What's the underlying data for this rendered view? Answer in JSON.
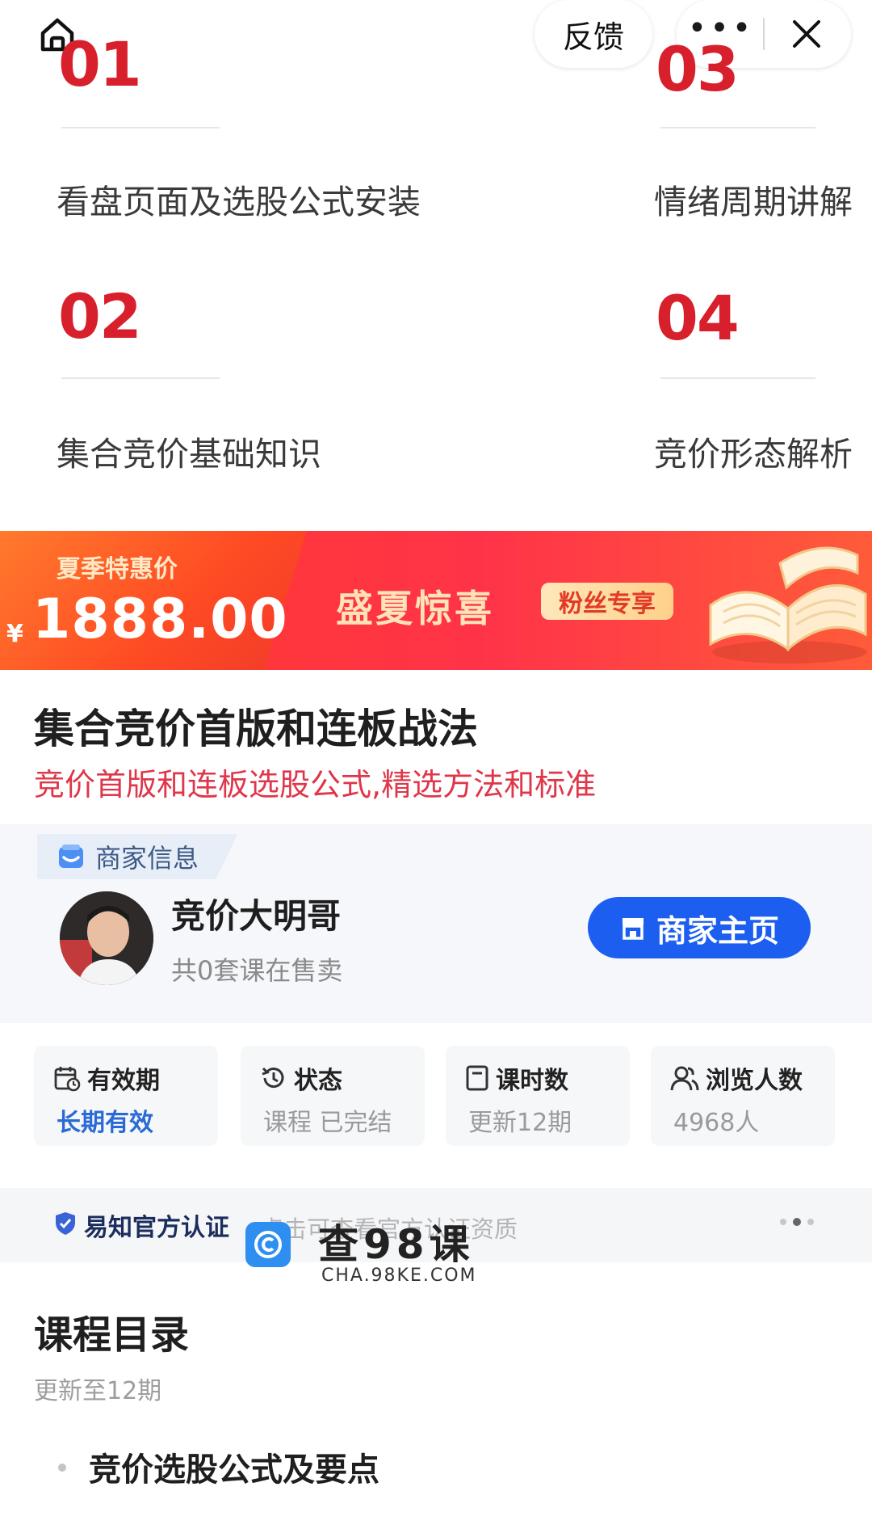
{
  "nav": {
    "feedback_label": "反馈",
    "more_label": "•••"
  },
  "chapters": [
    {
      "num": "01",
      "title": "看盘页面及选股公式安装"
    },
    {
      "num": "03",
      "title": "情绪周期讲解"
    },
    {
      "num": "02",
      "title": "集合竞价基础知识"
    },
    {
      "num": "04",
      "title": "竞价形态解析"
    }
  ],
  "banner": {
    "tag": "夏季特惠价",
    "currency": "¥",
    "price": "1888.00",
    "promo": "盛夏惊喜",
    "badge": "粉丝专享"
  },
  "course": {
    "title": "集合竞价首版和连板战法",
    "subtitle": "竞价首版和连板选股公式,精选方法和标准"
  },
  "merchant": {
    "section_label": "商家信息",
    "name": "竞价大明哥",
    "course_count": "共0套课在售卖",
    "home_button": "商家主页"
  },
  "stats": [
    {
      "label": "有效期",
      "value": "长期有效",
      "icon": "calendar-icon"
    },
    {
      "label": "状态",
      "value": "课程 已完结",
      "icon": "history-icon"
    },
    {
      "label": "课时数",
      "value": "更新12期",
      "icon": "document-icon"
    },
    {
      "label": "浏览人数",
      "value": "4968人",
      "icon": "users-icon"
    }
  ],
  "certification": {
    "label": "易知官方认证",
    "hint": "点击可查看官方认证资质"
  },
  "watermark": {
    "text": "查98课",
    "url": "CHA.98KE.COM"
  },
  "catalog": {
    "title": "课程目录",
    "subtitle": "更新至12期",
    "items": [
      "竞价选股公式及要点"
    ]
  },
  "colors": {
    "accent_red": "#d8202c",
    "subtitle_pink": "#e0364a",
    "primary_blue": "#1b5ef0"
  }
}
